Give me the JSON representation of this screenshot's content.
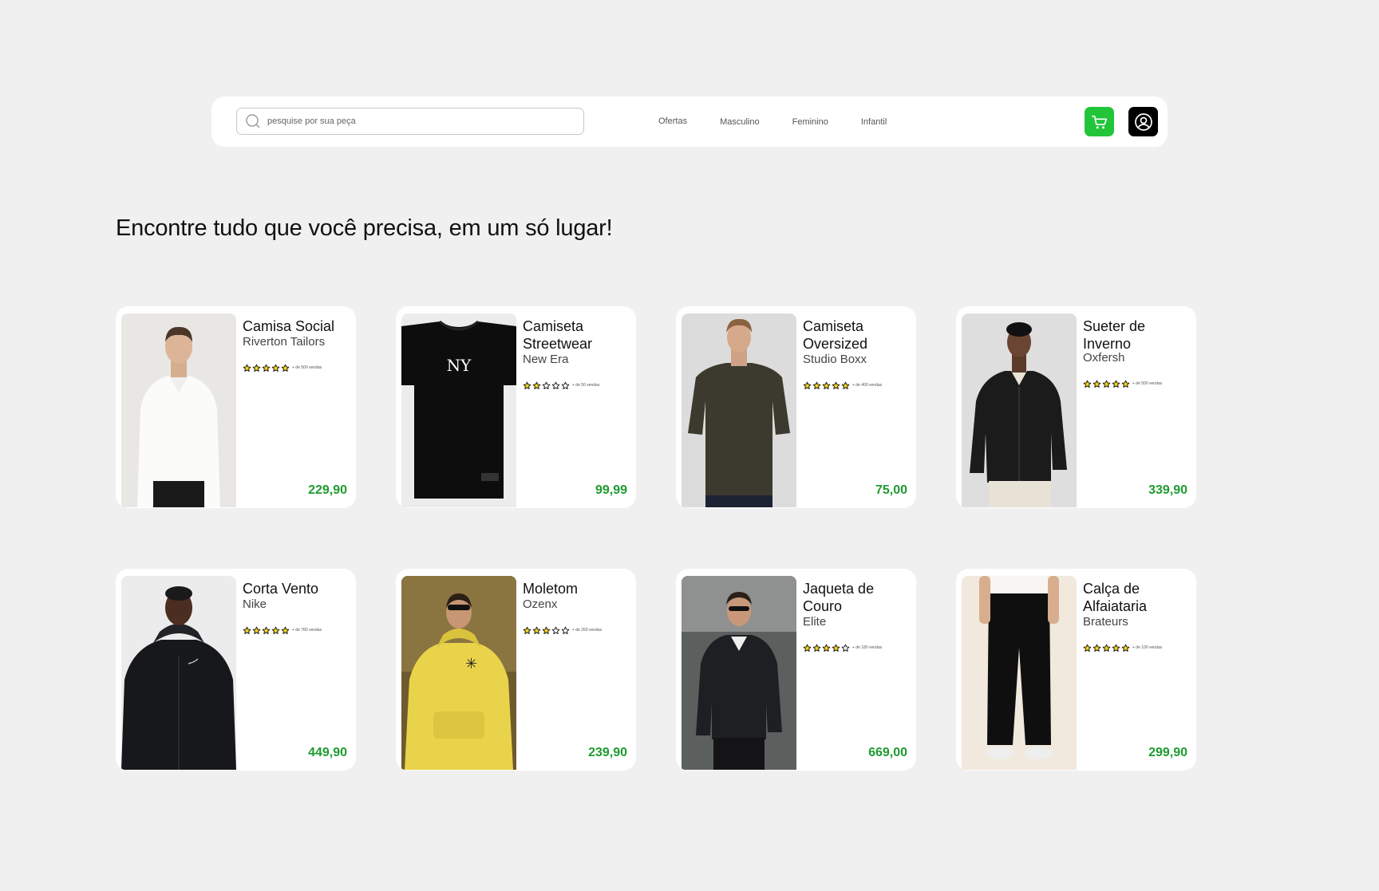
{
  "header": {
    "search": {
      "placeholder": "pesquise por sua peça",
      "value": ""
    },
    "nav": [
      "Ofertas",
      "Masculino",
      "Feminino",
      "Infantil"
    ],
    "cart_icon": "cart-icon",
    "user_icon": "user-circle-icon"
  },
  "colors": {
    "accent": "#22c53a",
    "price": "#1e9b2f",
    "background": "#f0f0f0"
  },
  "main": {
    "title": "Encontre tudo que você precisa, em um só lugar!",
    "products": [
      {
        "name": "Camisa Social",
        "brand": "Riverton Tailors",
        "stars": 5,
        "sales": "+ de 500 vendas",
        "price": "229,90"
      },
      {
        "name": "Camiseta Streetwear",
        "brand": "New Era",
        "stars": 2,
        "sales": "+ de 50 vendas",
        "price": "99,99"
      },
      {
        "name": "Camiseta Oversized",
        "brand": "Studio Boxx",
        "stars": 5,
        "sales": "+ de 400 vendas",
        "price": "75,00"
      },
      {
        "name": "Sueter de Inverno",
        "brand": "Oxfersh",
        "stars": 5,
        "sales": "+ de 500 vendas",
        "price": "339,90"
      },
      {
        "name": "Corta Vento",
        "brand": "Nike",
        "stars": 5,
        "sales": "+ de 780 vendas",
        "price": "449,90"
      },
      {
        "name": "Moletom",
        "brand": "Ozenx",
        "stars": 3,
        "sales": "+ de 250 vendas",
        "price": "239,90"
      },
      {
        "name": "Jaqueta de Couro",
        "brand": "Elite",
        "stars": 4,
        "sales": "+ de 180 vendas",
        "price": "669,00"
      },
      {
        "name": "Calça de Alfaiataria",
        "brand": "Brateurs",
        "stars": 5,
        "sales": "+ de 100 vendas",
        "price": "299,90"
      }
    ]
  }
}
